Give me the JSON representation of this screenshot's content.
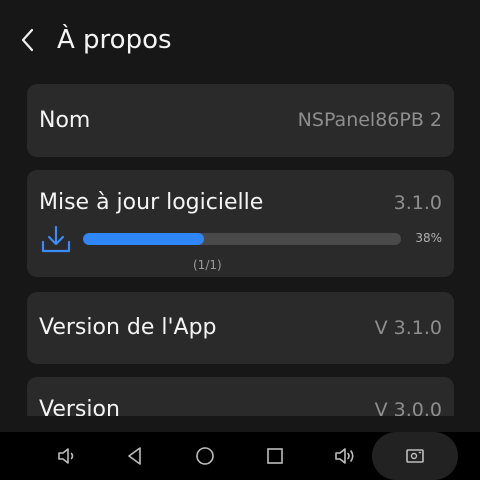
{
  "header": {
    "title": "À propos"
  },
  "rows": {
    "name": {
      "label": "Nom",
      "value": "NSPanel86PB 2"
    },
    "update": {
      "label": "Mise à jour logicielle",
      "value": "3.1.0",
      "progress_fraction": 0.38,
      "progress_text": "38%",
      "count_text": "(1/1)"
    },
    "app_version": {
      "label": "Version de l'App",
      "value": "V 3.1.0"
    },
    "version": {
      "label": "Version",
      "value": "V 3.0.0"
    }
  },
  "colors": {
    "accent": "#2f86f6",
    "card": "#2a2a2a",
    "background": "#171717"
  },
  "navbar": {
    "icons": [
      "volume-down-icon",
      "back-triangle-icon",
      "home-circle-icon",
      "recents-square-icon",
      "volume-up-icon",
      "screenshot-icon"
    ]
  }
}
